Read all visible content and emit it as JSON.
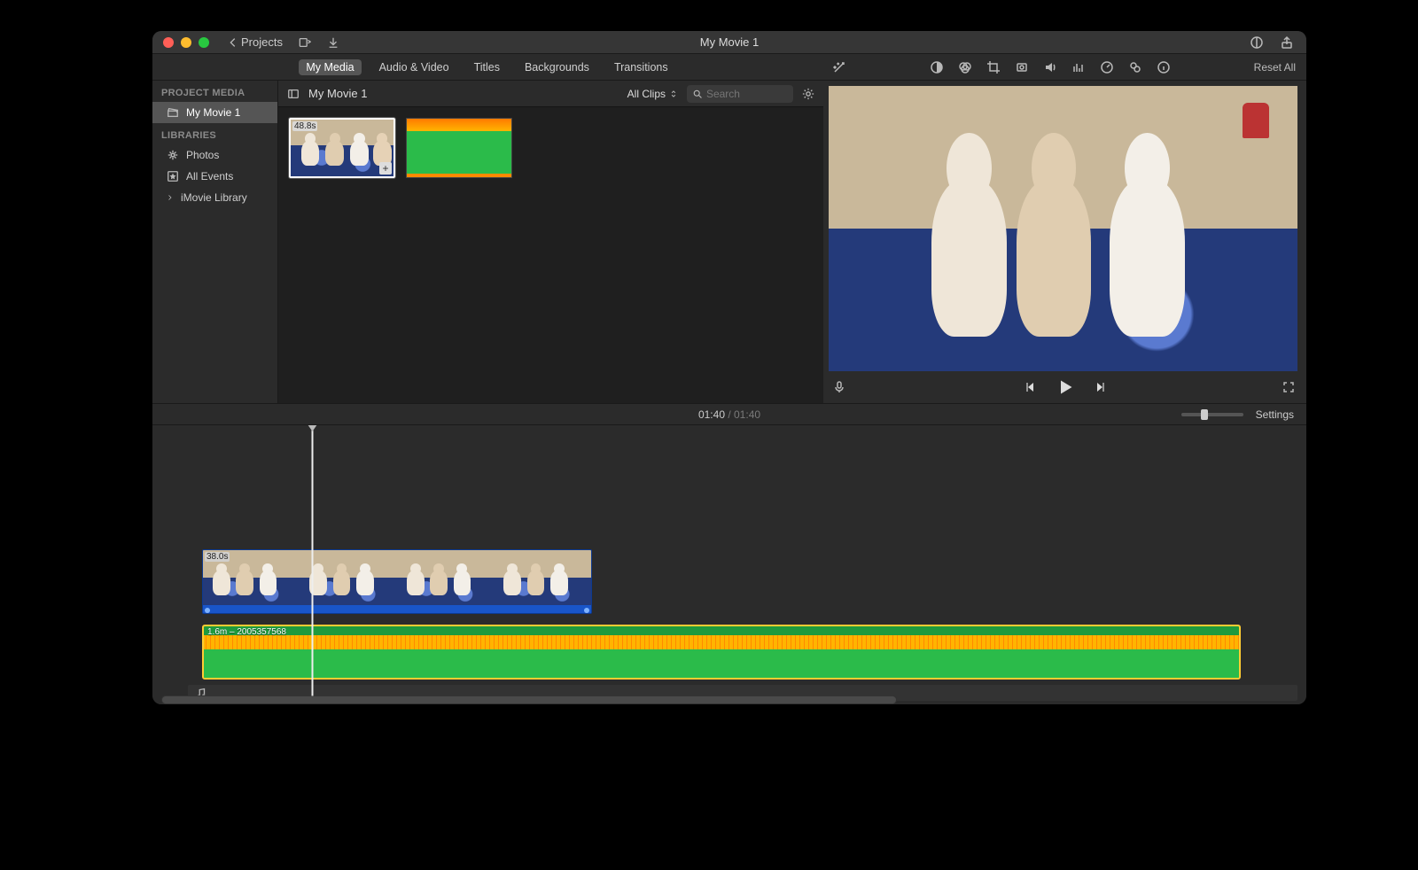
{
  "titlebar": {
    "back_label": "Projects",
    "title": "My Movie 1"
  },
  "tabs": {
    "items": [
      "My Media",
      "Audio & Video",
      "Titles",
      "Backgrounds",
      "Transitions"
    ],
    "active_index": 0
  },
  "viewer_tools": {
    "reset": "Reset All"
  },
  "sidebar": {
    "section1": "PROJECT MEDIA",
    "project_name": "My Movie 1",
    "section2": "LIBRARIES",
    "items": [
      "Photos",
      "All Events",
      "iMovie Library"
    ]
  },
  "browser": {
    "title": "My Movie 1",
    "filter": "All Clips",
    "search_placeholder": "Search",
    "clip_duration": "48.8s"
  },
  "timebar": {
    "current": "01:40",
    "total": "01:40",
    "settings": "Settings"
  },
  "timeline": {
    "video_duration": "38.0s",
    "audio_label": "1.6m – 2005357568"
  }
}
